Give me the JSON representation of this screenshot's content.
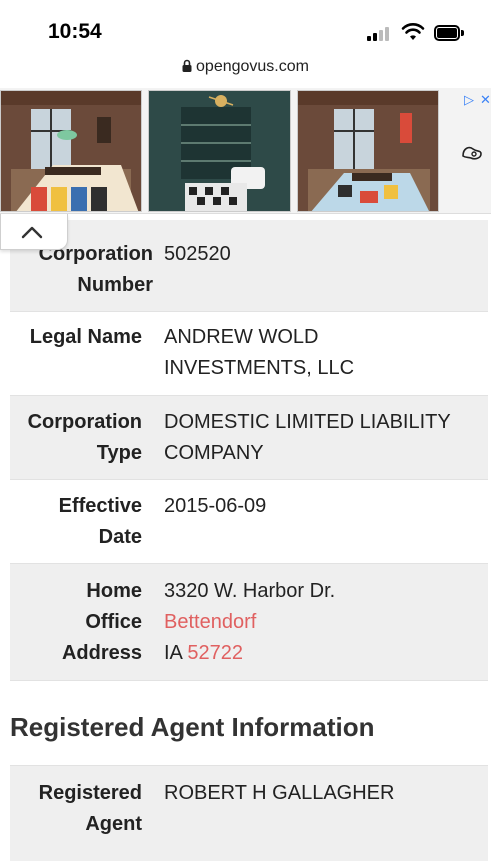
{
  "status_bar": {
    "time": "10:54"
  },
  "browser": {
    "url": "opengovus.com"
  },
  "corporation": {
    "number_label": "Corporation Number",
    "number_label_l1": "Corporation",
    "number_label_l2": "Number",
    "number": "502520",
    "legal_name_label": "Legal Name",
    "legal_name_l1": "ANDREW WOLD",
    "legal_name_l2": "INVESTMENTS, LLC",
    "type_label_l1": "Corporation",
    "type_label_l2": "Type",
    "type_l1": "DOMESTIC LIMITED LIABILITY",
    "type_l2": "COMPANY",
    "effective_label_l1": "Effective",
    "effective_label_l2": "Date",
    "effective_date": "2015-06-09",
    "address_label_l1": "Home",
    "address_label_l2": "Office",
    "address_label_l3": "Address",
    "address_street": "3320 W. Harbor Dr.",
    "address_city": "Bettendorf",
    "address_state": "IA",
    "address_zip": "52722"
  },
  "registered_agent": {
    "section_title": "Registered Agent Information",
    "label_l1": "Registered",
    "label_l2": "Agent",
    "name": "ROBERT H GALLAGHER"
  },
  "colors": {
    "link": "#e06060",
    "shaded_row": "#efefef",
    "ad_choices": "#3b82f6"
  },
  "icons": [
    "lock-icon",
    "signal-icon",
    "wifi-icon",
    "battery-icon",
    "chevron-up-icon",
    "ad-choices-icon",
    "close-icon"
  ]
}
